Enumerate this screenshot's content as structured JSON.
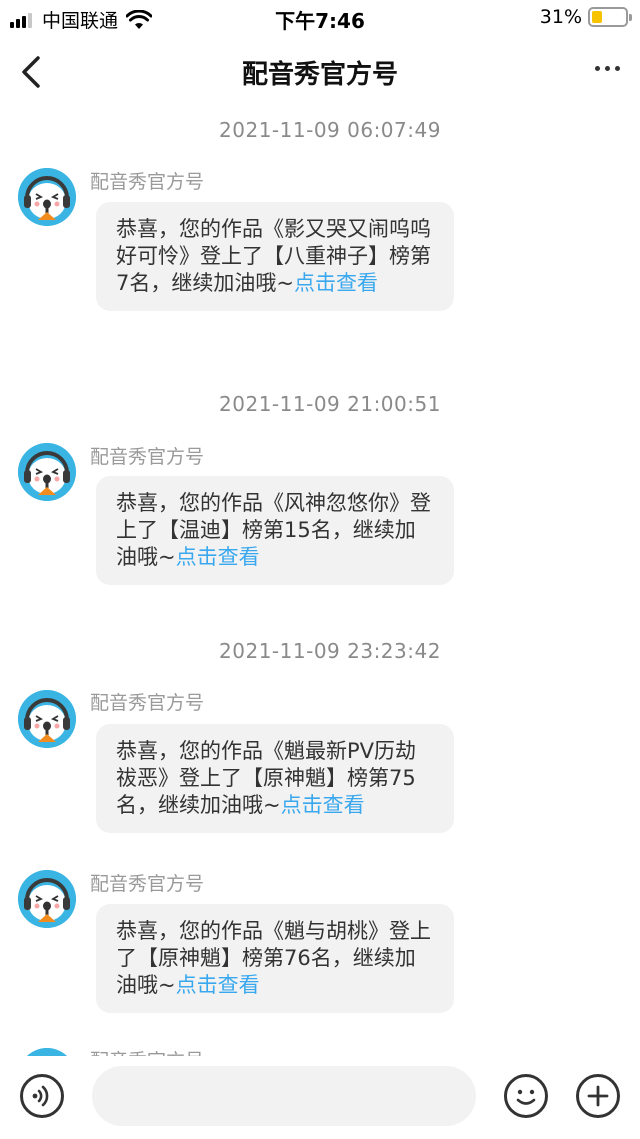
{
  "status_bar": {
    "carrier": "中国联通",
    "time": "下午7:46",
    "battery_percent": "31%",
    "battery_level": 0.31,
    "battery_color": "#f7c300",
    "signal_bars_active": 3
  },
  "nav": {
    "title": "配音秀官方号",
    "back_icon": "chevron-left-icon",
    "more_icon": "more-dots-icon"
  },
  "messages": [
    {
      "timestamp": "2021-11-09 06:07:49",
      "sender": "配音秀官方号",
      "text": "恭喜，您的作品《影又哭又闹呜呜好可怜》登上了【八重神子】榜第7名，继续加油哦~",
      "link": "点击查看"
    },
    {
      "timestamp": "2021-11-09 21:00:51",
      "sender": "配音秀官方号",
      "text": "恭喜，您的作品《风神忽悠你》登上了【温迪】榜第15名，继续加油哦~",
      "link": "点击查看"
    },
    {
      "timestamp": "2021-11-09 23:23:42",
      "sender": "配音秀官方号",
      "text": "恭喜，您的作品《魈最新PV历劫祓恶》登上了【原神魈】榜第75名，继续加油哦~",
      "link": "点击查看"
    },
    {
      "timestamp": "",
      "sender": "配音秀官方号",
      "text": "恭喜，您的作品《魈与胡桃》登上了【原神魈】榜第76名，继续加油哦~",
      "link": "点击查看"
    },
    {
      "timestamp": "",
      "sender": "配音秀官方号",
      "text": "",
      "link": ""
    }
  ],
  "input_bar": {
    "voice_icon": "voice-icon",
    "placeholder": "",
    "emoji_icon": "emoji-icon",
    "plus_icon": "plus-icon"
  },
  "colors": {
    "link": "#3aa8ee",
    "bubble": "#f2f2f2",
    "avatar_bg": "#3ab5e3"
  }
}
